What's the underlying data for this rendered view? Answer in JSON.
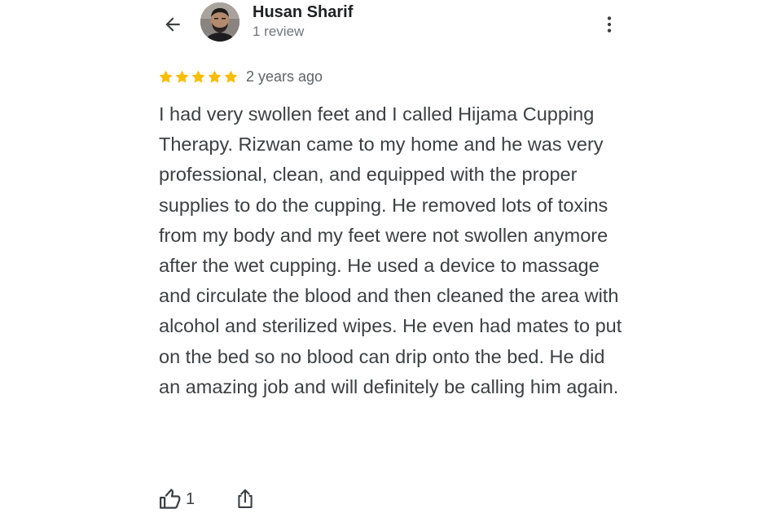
{
  "reviewer": {
    "name": "Husan Sharif",
    "meta": "1 review"
  },
  "review": {
    "rating": 5,
    "max_rating": 5,
    "star_color": "#fbbc04",
    "date": "2 years ago",
    "text": "I had very swollen feet and I called Hijama Cupping Therapy. Rizwan came to my home and he was very professional, clean, and equipped with the proper supplies to do the cupping. He removed lots of toxins from my body and my feet were not swollen anymore after the wet cupping. He used a device to massage and circulate the blood and then cleaned the area with alcohol and sterilized wipes. He even had mates to put on the bed so no blood can drip onto the bed. He did an amazing job and will definitely be calling him again."
  },
  "actions": {
    "like_count": "1"
  },
  "icons": {
    "back": "arrow-left-icon",
    "menu": "more-vertical-icon",
    "like": "thumbs-up-icon",
    "share": "share-icon",
    "star": "star-icon"
  }
}
